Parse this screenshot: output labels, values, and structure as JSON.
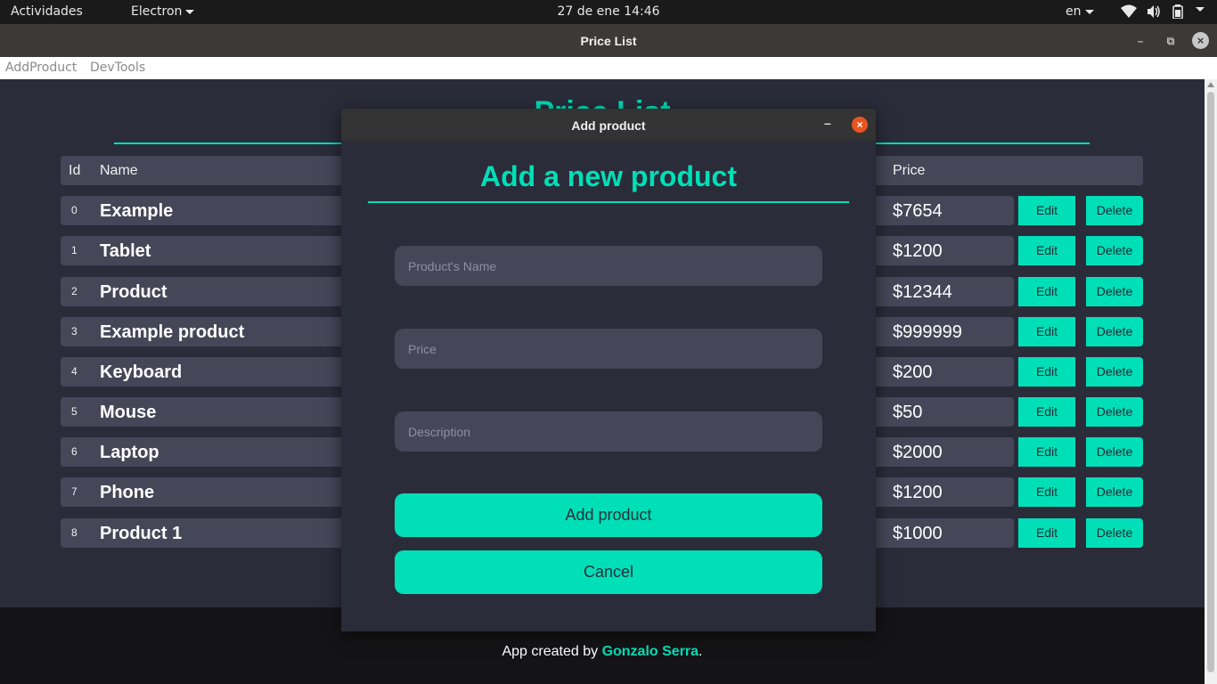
{
  "topbar": {
    "activities": "Actividades",
    "app_menu": "Electron",
    "clock": "27 de ene  14:46",
    "lang": "en"
  },
  "window": {
    "title": "Price List"
  },
  "menubar": {
    "items": [
      "AddProduct",
      "DevTools"
    ]
  },
  "page": {
    "title": "Price List",
    "table": {
      "headers": {
        "id": "Id",
        "name": "Name",
        "price": "Price"
      },
      "rows": [
        {
          "id": "0",
          "name": "Example",
          "price": "$7654"
        },
        {
          "id": "1",
          "name": "Tablet",
          "price": "$1200"
        },
        {
          "id": "2",
          "name": "Product",
          "price": "$12344"
        },
        {
          "id": "3",
          "name": "Example product",
          "price": "$999999"
        },
        {
          "id": "4",
          "name": "Keyboard",
          "price": "$200"
        },
        {
          "id": "5",
          "name": "Mouse",
          "price": "$50"
        },
        {
          "id": "6",
          "name": "Laptop",
          "price": "$2000"
        },
        {
          "id": "7",
          "name": "Phone",
          "price": "$1200"
        },
        {
          "id": "8",
          "name": "Product 1",
          "price": "$1000"
        }
      ],
      "edit_label": "Edit",
      "delete_label": "Delete"
    },
    "footer": {
      "prefix": "App created by ",
      "author": "Gonzalo Serra",
      "suffix": "."
    }
  },
  "dialog": {
    "title": "Add product",
    "heading": "Add a new product",
    "fields": {
      "name_placeholder": "Product's Name",
      "price_placeholder": "Price",
      "description_placeholder": "Description"
    },
    "add_label": "Add product",
    "cancel_label": "Cancel"
  },
  "colors": {
    "accent": "#00dfb8",
    "background": "#2b2c3a",
    "row": "#454758",
    "close": "#e95420"
  }
}
